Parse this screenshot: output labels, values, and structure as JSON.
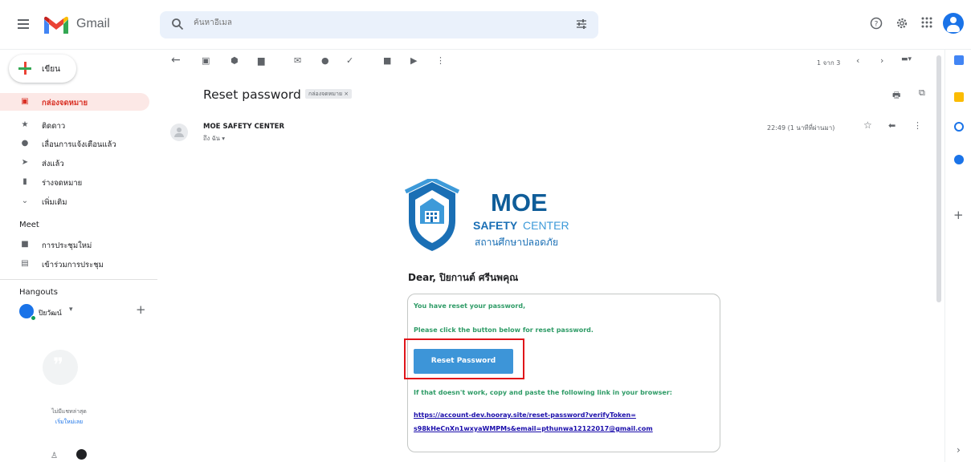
{
  "app": {
    "title": "Gmail"
  },
  "search": {
    "placeholder": "ค้นหาอีเมล"
  },
  "compose": {
    "label": "เขียน"
  },
  "nav": [
    {
      "icon": "inbox-icon",
      "label": "กล่องจดหมาย",
      "active": true
    },
    {
      "icon": "star-icon",
      "label": "ติดดาว"
    },
    {
      "icon": "clock-icon",
      "label": "เลื่อนการแจ้งเตือนแล้ว"
    },
    {
      "icon": "send-icon",
      "label": "ส่งแล้ว"
    },
    {
      "icon": "draft-icon",
      "label": "ร่างจดหมาย"
    },
    {
      "icon": "chevron-down-icon",
      "label": "เพิ่มเติม"
    }
  ],
  "meet": {
    "title": "Meet",
    "items": [
      {
        "icon": "video-icon",
        "label": "การประชุมใหม่"
      },
      {
        "icon": "keyboard-icon",
        "label": "เข้าร่วมการประชุม"
      }
    ]
  },
  "hangouts": {
    "title": "Hangouts",
    "user": "ปิยวัฒน์",
    "empty_text": "ไม่มีแชทล่าสุด",
    "start_link": "เริ่มใหม่เลย"
  },
  "toolbar": {
    "pagination": "1 จาก 3"
  },
  "email": {
    "subject": "Reset password",
    "label": "กล่องจดหมาย ×",
    "sender": "MOE SAFETY CENTER",
    "to": "ถึง ฉัน ▾",
    "time": "22:49 (1 นาทีที่ผ่านมา)",
    "logo": {
      "moe": "MOE",
      "safety": "SAFETY",
      "center": "CENTER",
      "thai": "สถานศึกษาปลอดภัย"
    },
    "greeting": "Dear, ปิยกานต์ ศรีนพคุณ",
    "line1": "You have reset your password,",
    "line2": "Please click the button below for reset password.",
    "button": "Reset Password",
    "line3": "If that doesn't work, copy and paste the following link in your browser:",
    "link1": "https://account-dev.hooray.site/reset-password?verifyToken=",
    "link2": "s98kHeCnXn1wxyaWMPMs&email=pthunwa12122017@gmail.com"
  },
  "colors": {
    "accent_red": "#d93025",
    "link": "#1a0dab",
    "green_text": "#2e9b66",
    "button_blue": "#3d95d8",
    "highlight_box": "#e0151a"
  }
}
